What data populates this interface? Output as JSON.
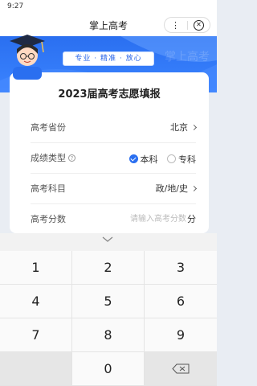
{
  "status_bar": {
    "time": "9:27"
  },
  "title_bar": {
    "title": "掌上高考",
    "more_icon": "⋮",
    "close_icon": "⊗"
  },
  "banner": {
    "slogan": "专业 · 精准 · 放心",
    "accent": "#2a6ff0"
  },
  "form": {
    "title": "2023届高考志愿填报",
    "province": {
      "label": "高考省份",
      "value": "北京"
    },
    "score_type": {
      "label": "成绩类型",
      "options": [
        "本科",
        "专科"
      ],
      "selected": "本科"
    },
    "subjects": {
      "label": "高考科目",
      "value": "政/地/史"
    },
    "score": {
      "label": "高考分数",
      "placeholder": "请输入高考分数",
      "unit": "分"
    }
  },
  "keyboard": {
    "keys": [
      "1",
      "2",
      "3",
      "4",
      "5",
      "6",
      "7",
      "8",
      "9",
      "",
      "0",
      ""
    ]
  }
}
